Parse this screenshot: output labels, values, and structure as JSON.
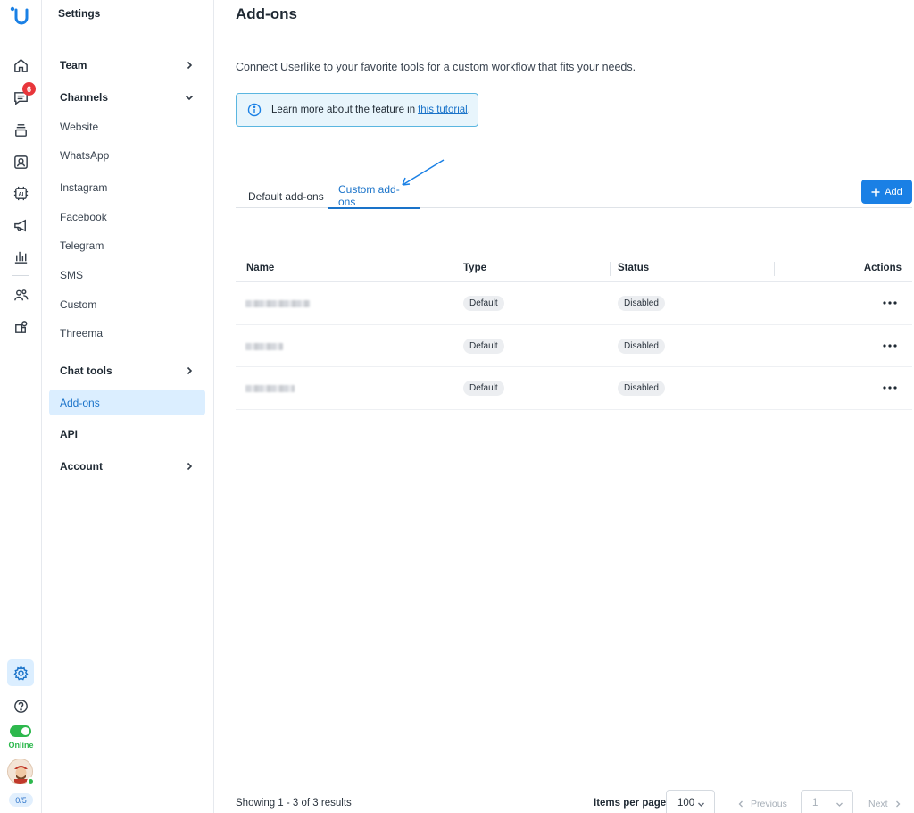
{
  "rail": {
    "chat_badge": "6",
    "online_label": "Online",
    "counter": "0/5",
    "icons": [
      "home-icon",
      "chat-icon",
      "inbox-icon",
      "contacts-icon",
      "ai-icon",
      "megaphone-icon",
      "analytics-icon",
      "team-icon",
      "addons-icon",
      "settings-icon",
      "help-icon"
    ]
  },
  "sidebar": {
    "title": "Settings",
    "team": "Team",
    "channels": "Channels",
    "channel_items": [
      "Website",
      "WhatsApp",
      "Instagram",
      "Facebook",
      "Telegram",
      "SMS",
      "Custom",
      "Threema"
    ],
    "chat_tools": "Chat tools",
    "addons": "Add-ons",
    "api": "API",
    "account": "Account"
  },
  "main": {
    "title": "Add-ons",
    "intro": "Connect Userlike to your favorite tools for a custom workflow that fits your needs.",
    "info_text": "Learn more about the feature in",
    "info_link": "this tutorial",
    "info_period": ".",
    "tabs": [
      {
        "label": "Default add-ons",
        "active": false
      },
      {
        "label": "Custom add-ons",
        "active": true
      }
    ],
    "add_button": "Add"
  },
  "table": {
    "headers": {
      "name": "Name",
      "type": "Type",
      "status": "Status",
      "actions": "Actions"
    },
    "rows": [
      {
        "type": "Default",
        "status": "Disabled"
      },
      {
        "type": "Default",
        "status": "Disabled"
      },
      {
        "type": "Default",
        "status": "Disabled"
      }
    ]
  },
  "footer": {
    "showing": "Showing 1 - 3 of 3 results",
    "items_per_page_label": "Items per page",
    "items_per_page_value": "100",
    "previous": "Previous",
    "page": "1",
    "next": "Next"
  },
  "colors": {
    "accent": "#1a80e5",
    "active_bg": "#dbeeff",
    "online": "#2db84d",
    "badge": "#e8363b"
  }
}
